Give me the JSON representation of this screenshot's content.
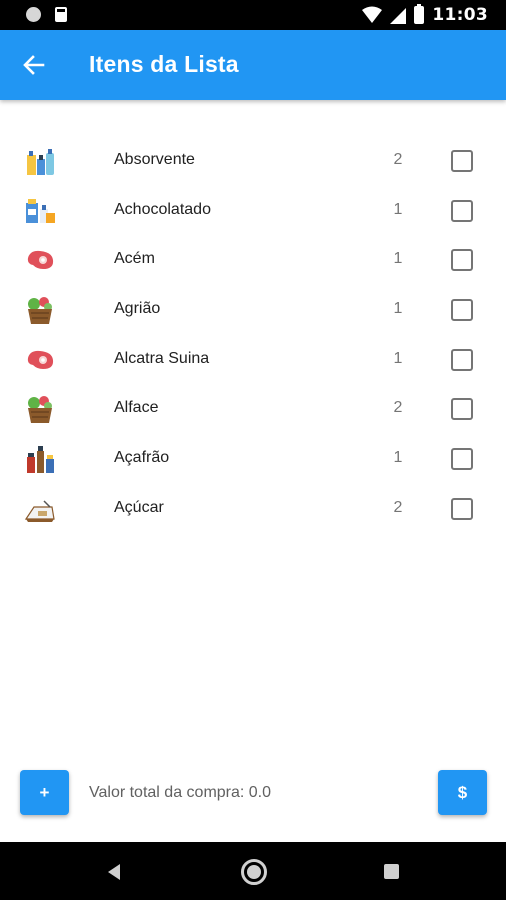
{
  "status_bar": {
    "time": "11:03"
  },
  "app_bar": {
    "title": "Itens da Lista"
  },
  "items": [
    {
      "name": "Absorvente",
      "quantity": "2",
      "icon": "hygiene-products-icon",
      "checked": false
    },
    {
      "name": "Achocolatado",
      "quantity": "1",
      "icon": "grocery-products-icon",
      "checked": false
    },
    {
      "name": "Acém",
      "quantity": "1",
      "icon": "meat-steak-icon",
      "checked": false
    },
    {
      "name": "Agrião",
      "quantity": "1",
      "icon": "vegetable-basket-icon",
      "checked": false
    },
    {
      "name": "Alcatra Suina",
      "quantity": "1",
      "icon": "meat-steak-icon",
      "checked": false
    },
    {
      "name": "Alface",
      "quantity": "2",
      "icon": "vegetable-basket-icon",
      "checked": false
    },
    {
      "name": "Açafrão",
      "quantity": "1",
      "icon": "spice-bottles-icon",
      "checked": false
    },
    {
      "name": "Açúcar",
      "quantity": "2",
      "icon": "sugar-bag-icon",
      "checked": false
    }
  ],
  "footer": {
    "add_label": "+",
    "total_label": "Valor total da compra: 0.0",
    "pay_label": "$"
  },
  "colors": {
    "primary": "#2196f3",
    "text": "#212121",
    "secondary_text": "#757575"
  }
}
